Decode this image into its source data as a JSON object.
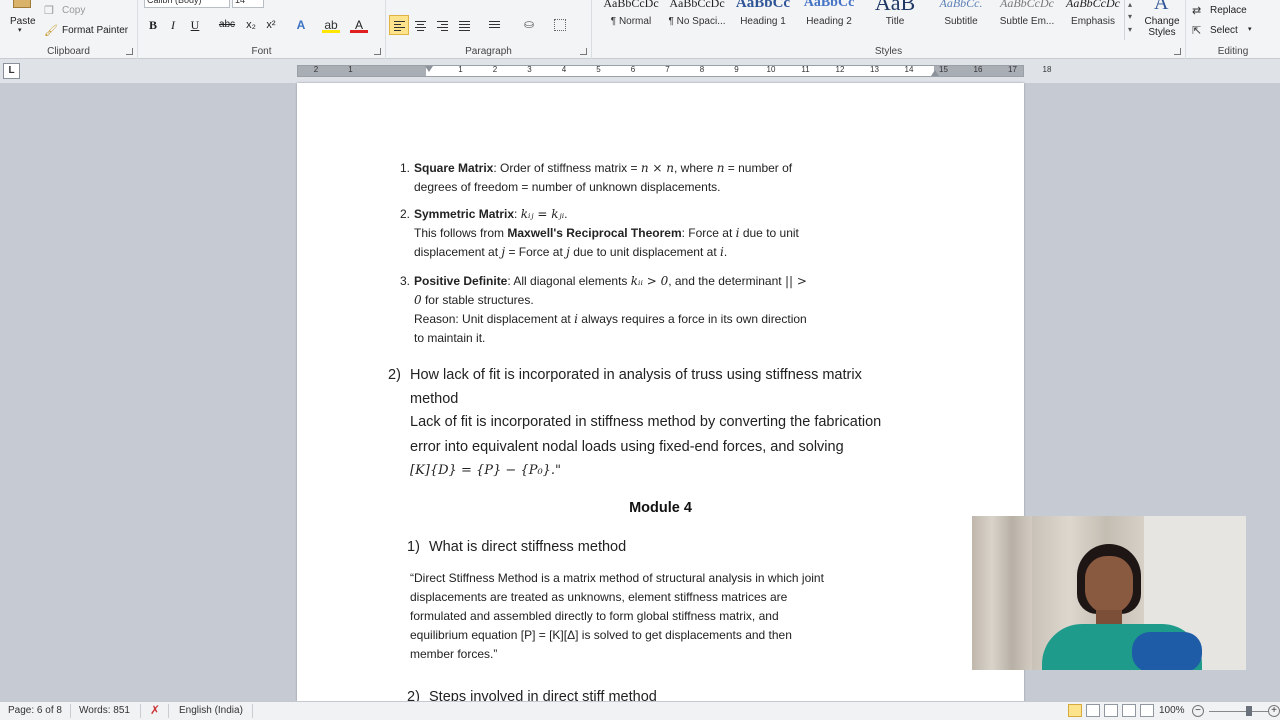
{
  "ribbon": {
    "clipboard": {
      "paste": "Paste",
      "copy": "Copy",
      "format_painter": "Format Painter",
      "label": "Clipboard"
    },
    "font": {
      "name": "Calibri (Body)",
      "size": "14",
      "label": "Font"
    },
    "paragraph": {
      "label": "Paragraph"
    },
    "styles": {
      "label": "Styles",
      "items": [
        {
          "sample": "AaBbCcDc",
          "name": "¶ Normal"
        },
        {
          "sample": "AaBbCcDc",
          "name": "¶ No Spaci..."
        },
        {
          "sample": "AaBbCc",
          "name": "Heading 1"
        },
        {
          "sample": "AaBbCc",
          "name": "Heading 2"
        },
        {
          "sample": "AaB",
          "name": "Title"
        },
        {
          "sample": "AaBbCc.",
          "name": "Subtitle"
        },
        {
          "sample": "AaBbCcDc",
          "name": "Subtle Em..."
        },
        {
          "sample": "AaBbCcDc",
          "name": "Emphasis"
        }
      ],
      "change_styles": "Change Styles"
    },
    "editing": {
      "replace": "Replace",
      "select": "Select",
      "label": "Editing"
    }
  },
  "ruler": {
    "numbers": [
      "2",
      "1",
      "1",
      "2",
      "3",
      "4",
      "5",
      "6",
      "7",
      "8",
      "9",
      "10",
      "11",
      "12",
      "13",
      "14",
      "15",
      "16",
      "17",
      "18"
    ]
  },
  "document": {
    "list_items": [
      {
        "num": "1.",
        "lines": [
          [
            {
              "t": "Square Matrix",
              "b": true
            },
            {
              "t": ": Order of stiffness matrix = "
            },
            {
              "t": "n × n",
              "m": true
            },
            {
              "t": ", where "
            },
            {
              "t": "n",
              "m": true
            },
            {
              "t": " = number of"
            }
          ],
          [
            {
              "t": "degrees of freedom = number of unknown displacements."
            }
          ]
        ]
      },
      {
        "num": "2.",
        "lines": [
          [
            {
              "t": "Symmetric Matrix",
              "b": true
            },
            {
              "t": ": "
            },
            {
              "t": "kᵢⱼ = kⱼᵢ",
              "m": true
            },
            {
              "t": "."
            }
          ],
          [
            {
              "t": "This follows from "
            },
            {
              "t": "Maxwell's Reciprocal Theorem",
              "b": true
            },
            {
              "t": ": Force at "
            },
            {
              "t": "i",
              "m": true
            },
            {
              "t": " due to unit"
            }
          ],
          [
            {
              "t": "displacement at "
            },
            {
              "t": "j",
              "m": true
            },
            {
              "t": " = Force at "
            },
            {
              "t": "j",
              "m": true
            },
            {
              "t": " due to unit displacement at "
            },
            {
              "t": "i",
              "m": true
            },
            {
              "t": "."
            }
          ]
        ]
      },
      {
        "num": "3.",
        "lines": [
          [
            {
              "t": "Positive Definite",
              "b": true
            },
            {
              "t": ": All diagonal elements "
            },
            {
              "t": "kᵢᵢ > 0",
              "m": true
            },
            {
              "t": ", and the determinant "
            },
            {
              "t": "|| >",
              "m": true
            }
          ],
          [
            {
              "t": "0",
              "m": true
            },
            {
              "t": " for stable structures."
            }
          ],
          [
            {
              "t": "Reason: Unit displacement at "
            },
            {
              "t": "i",
              "m": true
            },
            {
              "t": " always requires a force in its own direction"
            }
          ],
          [
            {
              "t": "to maintain it."
            }
          ]
        ]
      }
    ],
    "q2": {
      "num": "2)",
      "question_line1": "How lack of fit is incorporated in analysis of truss using stiffness matrix",
      "question_line2": "method",
      "answer_line1": "Lack of fit is incorporated in stiffness method by converting the fabrication",
      "answer_line2": "error into equivalent nodal loads using fixed-end forces, and solving",
      "answer_line3": "[K]{D} = {P} − {P₀}.\""
    },
    "module_title": "Module 4",
    "m4q1": {
      "num": "1)",
      "question": "What is direct stiffness method"
    },
    "m4a1": [
      "“Direct Stiffness Method is a matrix method of structural analysis in which joint",
      "displacements are treated as unknowns, element stiffness matrices are",
      "formulated and assembled directly to form global stiffness matrix, and",
      "equilibrium equation [P] = [K][Δ] is solved to get displacements and then",
      "member forces.”"
    ],
    "m4q2": {
      "num": "2)",
      "question": "Steps involved in direct stiff method"
    }
  },
  "statusbar": {
    "page": "Page: 6 of 8",
    "words": "Words: 851",
    "language": "English (India)",
    "zoom": "100%"
  }
}
